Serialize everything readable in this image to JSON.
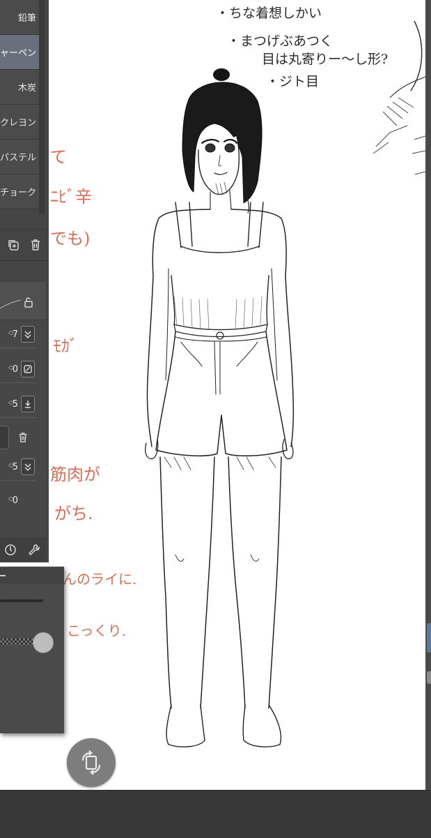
{
  "brush_list": {
    "items": [
      {
        "label": "鉛筆",
        "active": false
      },
      {
        "label": "シャーペン",
        "active": true
      },
      {
        "label": "木炭",
        "active": false
      },
      {
        "label": "クレヨン",
        "active": false
      },
      {
        "label": "パステル",
        "active": false
      },
      {
        "label": "チョーク",
        "active": false
      }
    ]
  },
  "tool_props": {
    "values": [
      "7",
      "0",
      "5",
      "5",
      "0"
    ]
  },
  "notes": {
    "black": [
      "・ちな着想しかい",
      "・まつげぶあつく",
      "目は丸寄りー～し形?",
      "・ジト目"
    ],
    "red": [
      "て",
      "ﾆﾋﾞ辛",
      "でも)",
      "ﾓｶﾞ",
      "筋肉が",
      "がち.",
      "んのライに.",
      "こっくり."
    ]
  },
  "colors": {
    "canvas": "#ffffff",
    "panel": "#454545",
    "active_item": "#6a6f7c",
    "red_note": "#d86d55",
    "scroll_accent": "#5c7a9e"
  }
}
